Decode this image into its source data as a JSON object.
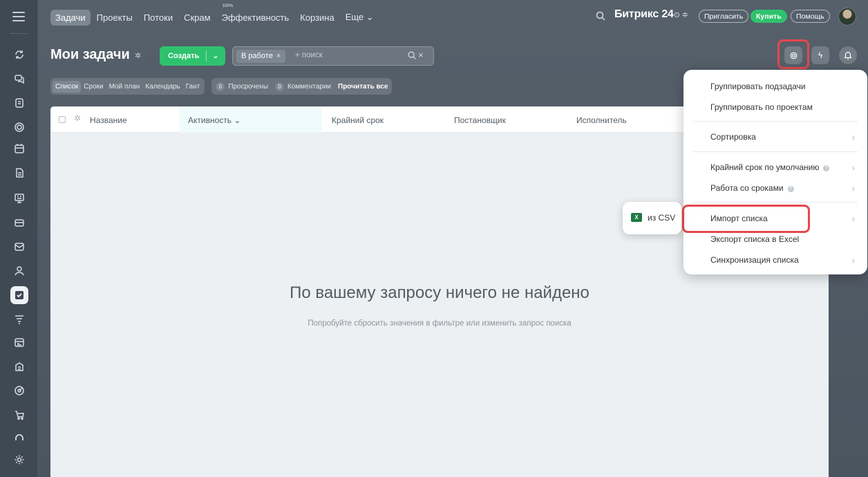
{
  "topnav": {
    "items": [
      {
        "label": "Задачи",
        "active": true
      },
      {
        "label": "Проекты"
      },
      {
        "label": "Потоки"
      },
      {
        "label": "Скрам"
      },
      {
        "label": "Эффективность",
        "badge": "100%"
      },
      {
        "label": "Корзина"
      },
      {
        "label": "Еще ⌄"
      }
    ],
    "brand": "Битрикс 24",
    "brand_suffix": "⊙ ≑",
    "invite_label": "Пригласить",
    "buy_label": "Купить",
    "help_label": "Помощь"
  },
  "page": {
    "title": "Мои задачи",
    "create_label": "Создать",
    "filter_chip": "В работе",
    "filter_placeholder": "+ поиск"
  },
  "views": {
    "tabs": [
      "Список",
      "Сроки",
      "Мой план",
      "Календарь",
      "Гант"
    ],
    "active_tab": "Список",
    "overdue_count": "0",
    "overdue_label": "Просрочены",
    "comments_count": "0",
    "comments_label": "Комментарии",
    "read_all_label": "Прочитать все"
  },
  "table": {
    "columns": [
      "Название",
      "Активность ⌄",
      "Крайний срок",
      "Постановщик",
      "Исполнитель"
    ],
    "active_column": "Активность"
  },
  "empty_state": {
    "title": "По вашему запросу ничего не найдено",
    "subtitle": "Попробуйте сбросить значения в фильтре или изменить запрос поиска"
  },
  "settings_menu": {
    "items": [
      {
        "label": "Группировать подзадачи"
      },
      {
        "label": "Группировать по проектам"
      },
      {
        "label": "Сортировка"
      },
      {
        "label": "Крайний срок по умолчанию"
      },
      {
        "label": "Работа со сроками"
      },
      {
        "label": "Импорт списка"
      },
      {
        "label": "Экспорт списка в Excel"
      },
      {
        "label": "Синхронизация списка"
      }
    ]
  },
  "import_submenu": {
    "icon_text": "X",
    "label": "из CSV"
  },
  "colors": {
    "accent_green": "#2fc26e",
    "highlight_red": "#e5484d",
    "sidebar_bg": "#3f4954"
  },
  "sidebar_icons": [
    "sync-icon",
    "chat-icon",
    "feed-icon",
    "target-icon",
    "calendar-icon",
    "document-icon",
    "board-icon",
    "card-icon",
    "mail-icon",
    "contacts-icon",
    "tasks-icon",
    "filter-icon",
    "shift-calendar-icon",
    "building-icon",
    "goal-icon",
    "cart-icon",
    "arch-icon",
    "settings-icon"
  ]
}
